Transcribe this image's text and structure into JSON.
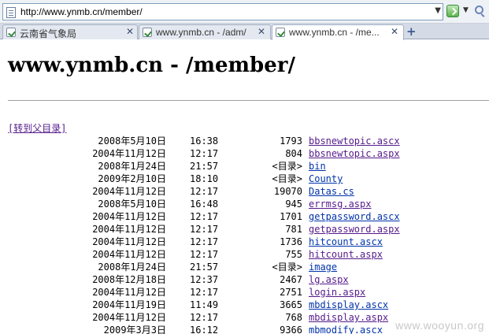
{
  "browser": {
    "url": "http://www.ynmb.cn/member/",
    "tabs": [
      {
        "label": "云南省气象局",
        "active": false
      },
      {
        "label": "www.ynmb.cn - /adm/",
        "active": false
      },
      {
        "label": "www.ynmb.cn - /me...",
        "active": true
      }
    ],
    "new_tab_glyph": "+",
    "close_glyph": "✕"
  },
  "page": {
    "title": "www.ynmb.cn - /member/",
    "parent_link": "[转到父目录]",
    "entries": [
      {
        "date": "2008年5月10日",
        "time": "16:38",
        "size": "1793",
        "name": "bbsnewtopic.ascx",
        "visited": true
      },
      {
        "date": "2004年11月12日",
        "time": "12:17",
        "size": "804",
        "name": "bbsnewtopic.aspx",
        "visited": true
      },
      {
        "date": "2008年1月24日",
        "time": "21:57",
        "size": "<目录>",
        "name": "bin",
        "visited": false
      },
      {
        "date": "2009年2月10日",
        "time": "18:10",
        "size": "<目录>",
        "name": "County",
        "visited": false
      },
      {
        "date": "2004年11月12日",
        "time": "12:17",
        "size": "19070",
        "name": "Datas.cs",
        "visited": false
      },
      {
        "date": "2008年5月10日",
        "time": "16:48",
        "size": "945",
        "name": "errmsg.aspx",
        "visited": true
      },
      {
        "date": "2004年11月12日",
        "time": "12:17",
        "size": "1701",
        "name": "getpassword.ascx",
        "visited": false
      },
      {
        "date": "2004年11月12日",
        "time": "12:17",
        "size": "781",
        "name": "getpassword.aspx",
        "visited": true
      },
      {
        "date": "2004年11月12日",
        "time": "12:17",
        "size": "1736",
        "name": "hitcount.ascx",
        "visited": false
      },
      {
        "date": "2004年11月12日",
        "time": "12:17",
        "size": "755",
        "name": "hitcount.aspx",
        "visited": true
      },
      {
        "date": "2008年1月24日",
        "time": "21:57",
        "size": "<目录>",
        "name": "image",
        "visited": false
      },
      {
        "date": "2008年12月18日",
        "time": "12:37",
        "size": "2467",
        "name": "lg.aspx",
        "visited": true
      },
      {
        "date": "2004年11月12日",
        "time": "12:17",
        "size": "2751",
        "name": "login.aspx",
        "visited": true
      },
      {
        "date": "2004年11月19日",
        "time": "11:49",
        "size": "3665",
        "name": "mbdisplay.ascx",
        "visited": false
      },
      {
        "date": "2004年11月12日",
        "time": "12:17",
        "size": "768",
        "name": "mbdisplay.aspx",
        "visited": true
      },
      {
        "date": "2009年3月3日",
        "time": "16:12",
        "size": "9366",
        "name": "mbmodify.ascx",
        "visited": false
      }
    ]
  },
  "watermark": "www.wooyun.org",
  "colors": {
    "visited_link": "#551a8b",
    "link": "#0033aa"
  }
}
